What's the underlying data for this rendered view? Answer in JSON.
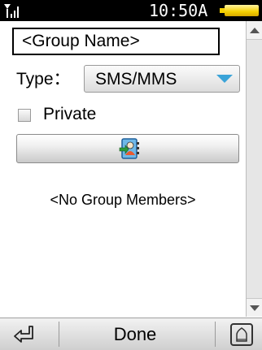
{
  "status_bar": {
    "time": "10:50A",
    "signal_icon": "signal-icon",
    "battery_icon": "battery-icon",
    "battery_color": "#f4d000"
  },
  "form": {
    "group_name": "<Group Name>",
    "type_label": "Type：",
    "type_value": "SMS/MMS",
    "private_label": "Private",
    "private_checked": false,
    "pick_icon": "contact-pick-icon",
    "empty_text": "<No Group Members>"
  },
  "bottom_bar": {
    "back_icon": "back-arrow-icon",
    "done_label": "Done",
    "home_icon": "home-icon"
  },
  "colors": {
    "accent": "#3aa3d8"
  }
}
